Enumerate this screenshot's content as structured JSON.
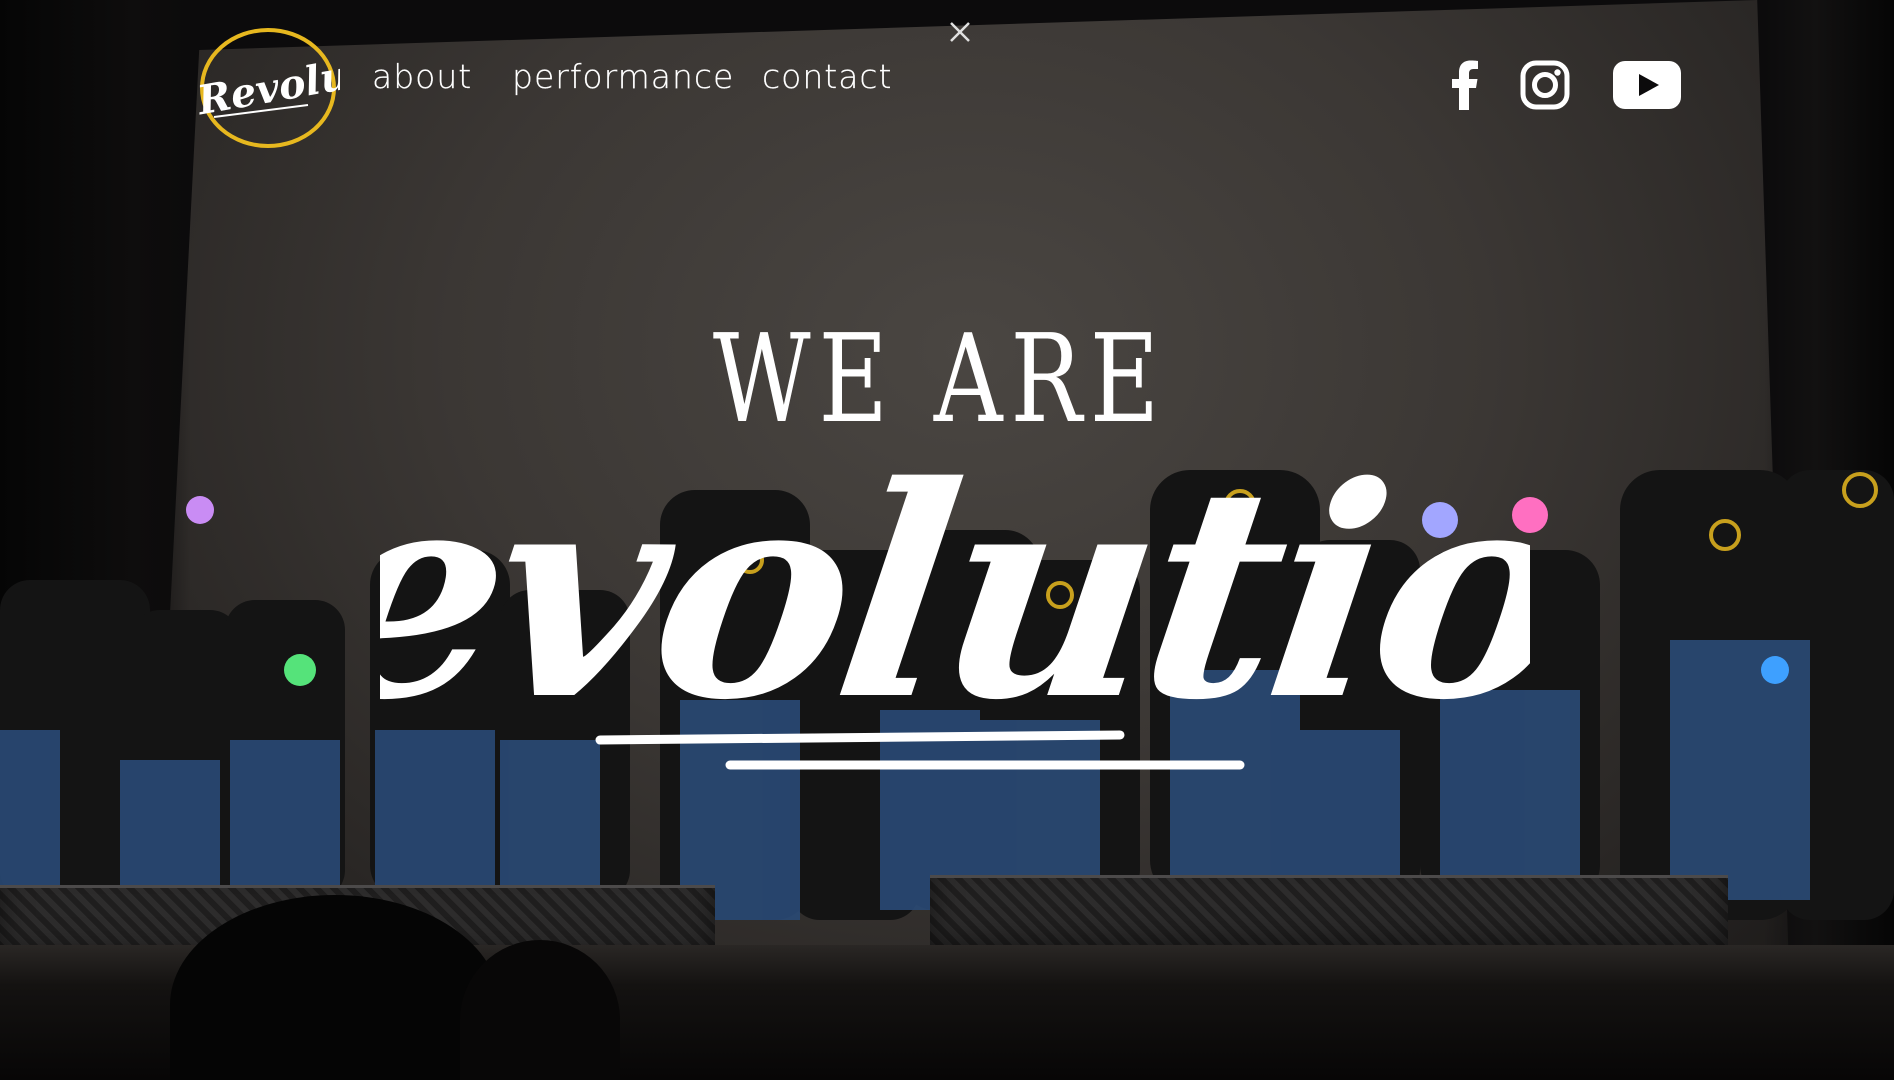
{
  "brand": {
    "logo_text": "Revolution",
    "ring_color": "#e7b81f"
  },
  "nav": {
    "items": [
      {
        "label": "about"
      },
      {
        "label": "performance"
      },
      {
        "label": "contact"
      }
    ]
  },
  "overlay": {
    "close_icon": "close-icon"
  },
  "social": [
    {
      "icon": "facebook-icon"
    },
    {
      "icon": "instagram-icon"
    },
    {
      "icon": "youtube-icon"
    }
  ],
  "hero": {
    "line1": "WE ARE",
    "line2": "Revolution"
  },
  "colors": {
    "text": "#ffffff",
    "backdrop": "#3b3734",
    "shirt_logo": "#e7b81f"
  }
}
